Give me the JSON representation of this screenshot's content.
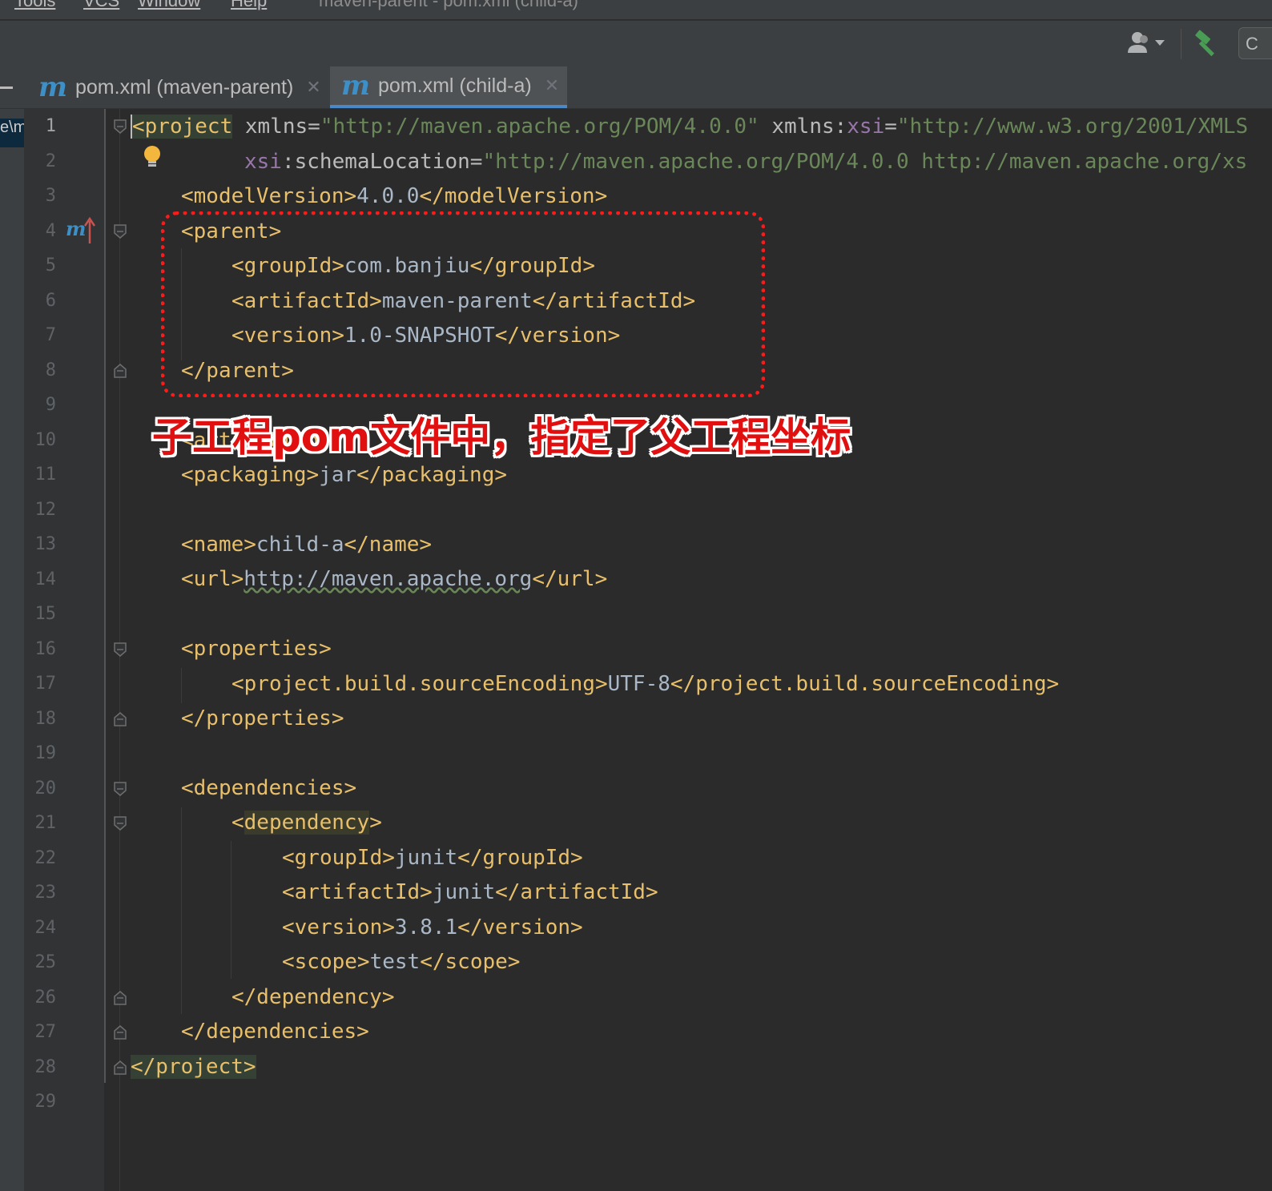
{
  "menubar": {
    "items": [
      "Tools",
      "VCS",
      "Window",
      "Help"
    ],
    "window_title": "maven-parent - pom.xml (child-a)"
  },
  "toolbar": {
    "user_icon": "user-icon",
    "build_icon": "hammer-icon",
    "combo_label": "C"
  },
  "tabs": [
    {
      "label": "pom.xml (maven-parent)",
      "icon": "maven-m-icon",
      "active": false
    },
    {
      "label": "pom.xml (child-a)",
      "icon": "maven-m-icon",
      "active": true
    }
  ],
  "left_strip": {
    "selected_text": "e\\m"
  },
  "editor": {
    "line_numbers": [
      "1",
      "2",
      "3",
      "4",
      "5",
      "6",
      "7",
      "8",
      "9",
      "10",
      "11",
      "12",
      "13",
      "14",
      "15",
      "16",
      "17",
      "18",
      "19",
      "20",
      "21",
      "22",
      "23",
      "24",
      "25",
      "26",
      "27",
      "28",
      "29"
    ],
    "current_line": 1,
    "code": {
      "l1_tag": "project",
      "l1_attr1": "xmlns",
      "l1_val1": "\"http://maven.apache.org/POM/4.0.0\"",
      "l1_attr2_ns": "xmlns:",
      "l1_attr2_name": "xsi",
      "l1_val2": "\"http://www.w3.org/2001/XMLS",
      "l2_ns": "xsi",
      "l2_attr": ":schemaLocation",
      "l2_val": "\"http://maven.apache.org/POM/4.0.0 http://maven.apache.org/xs",
      "l3_open": "<modelVersion>",
      "l3_text": "4.0.0",
      "l3_close": "</modelVersion>",
      "l4": "<parent>",
      "l5_open": "<groupId>",
      "l5_text": "com.banjiu",
      "l5_close": "</groupId>",
      "l6_open": "<artifactId>",
      "l6_text": "maven-parent",
      "l6_close": "</artifactId>",
      "l7_open": "<version>",
      "l7_text": "1.0-SNAPSHOT",
      "l7_close": "</version>",
      "l8": "</parent>",
      "l10_visible": "<artifactId>",
      "l11_open": "<packaging>",
      "l11_text": "jar",
      "l11_close": "</packaging>",
      "l13_open": "<name>",
      "l13_text": "child-a",
      "l13_close": "</name>",
      "l14_open": "<url>",
      "l14_text": "http://maven.apache.org",
      "l14_close": "</url>",
      "l16": "<properties>",
      "l17_open": "<project.build.sourceEncoding>",
      "l17_text": "UTF-8",
      "l17_close": "</project.build.sourceEncoding>",
      "l18": "</properties>",
      "l20": "<dependencies>",
      "l21_lt": "<",
      "l21_tag": "dependency",
      "l21_gt": ">",
      "l22_open": "<groupId>",
      "l22_text": "junit",
      "l22_close": "</groupId>",
      "l23_open": "<artifactId>",
      "l23_text": "junit",
      "l23_close": "</artifactId>",
      "l24_open": "<version>",
      "l24_text": "3.8.1",
      "l24_close": "</version>",
      "l25_open": "<scope>",
      "l25_text": "test",
      "l25_close": "</scope>",
      "l26": "</dependency>",
      "l27": "</dependencies>",
      "l28": "</project>"
    }
  },
  "annotation": {
    "text": "子工程pom文件中，指定了父工程坐标",
    "color": "#e01010"
  },
  "colors": {
    "tag": "#e8bf6a",
    "attr_value": "#6a8759",
    "namespace": "#9876aa",
    "text": "#a9b7c6",
    "maven_blue": "#3d8fc7",
    "annotation_red": "#ff1a1a"
  }
}
